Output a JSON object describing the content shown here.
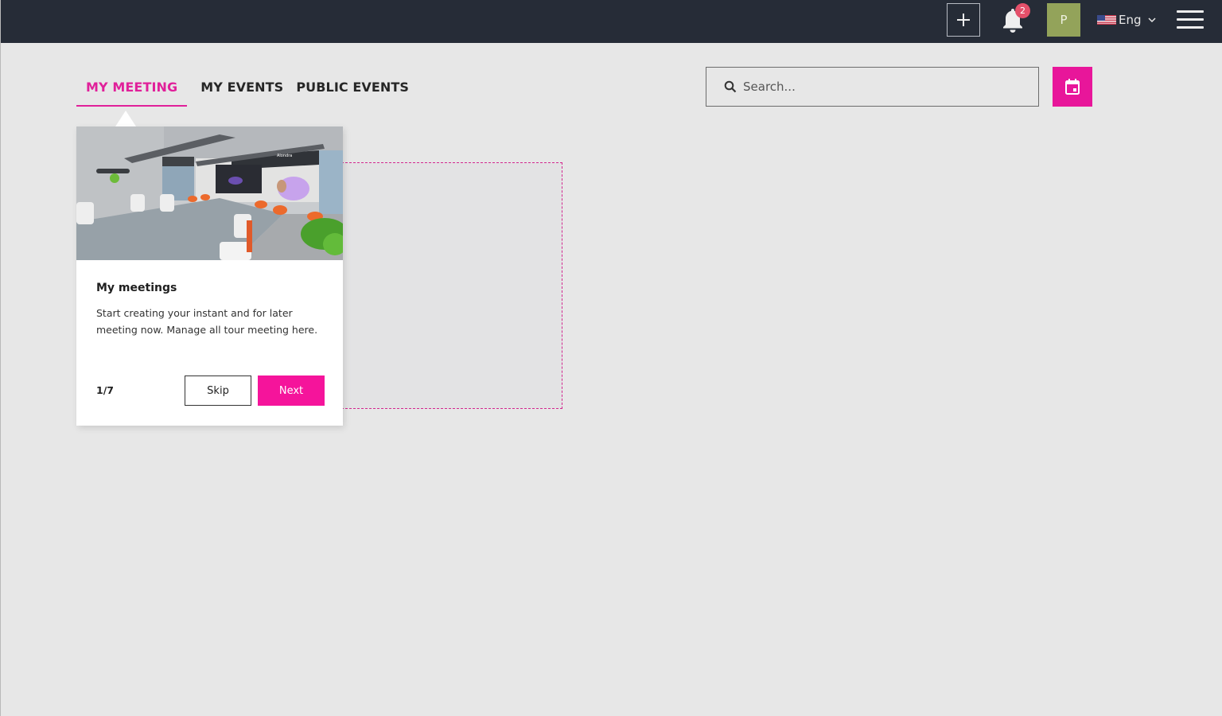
{
  "header": {
    "add_button_label": "+",
    "notifications": {
      "count": "2"
    },
    "avatar_initial": "P",
    "language": {
      "label": "Eng",
      "flag": "us-flag"
    },
    "colors": {
      "bar": "#262c37",
      "badge": "#e4506a",
      "avatar": "#93a35a"
    }
  },
  "tabs": [
    {
      "label": "MY MEETING",
      "active": true
    },
    {
      "label": "MY EVENTS",
      "active": false
    },
    {
      "label": "PUBLIC EVENTS",
      "active": false
    }
  ],
  "search": {
    "placeholder": "Search...",
    "value": ""
  },
  "calendar_button": {
    "icon": "calendar-icon"
  },
  "tour": {
    "title": "My meetings",
    "text": "Start creating your instant and for later meeting now. Manage all tour meeting here.",
    "step": "1/7",
    "skip_label": "Skip",
    "next_label": "Next",
    "image_caption": "Alondra",
    "image_description": "virtual meeting room"
  },
  "accent_color": "#e8169a"
}
